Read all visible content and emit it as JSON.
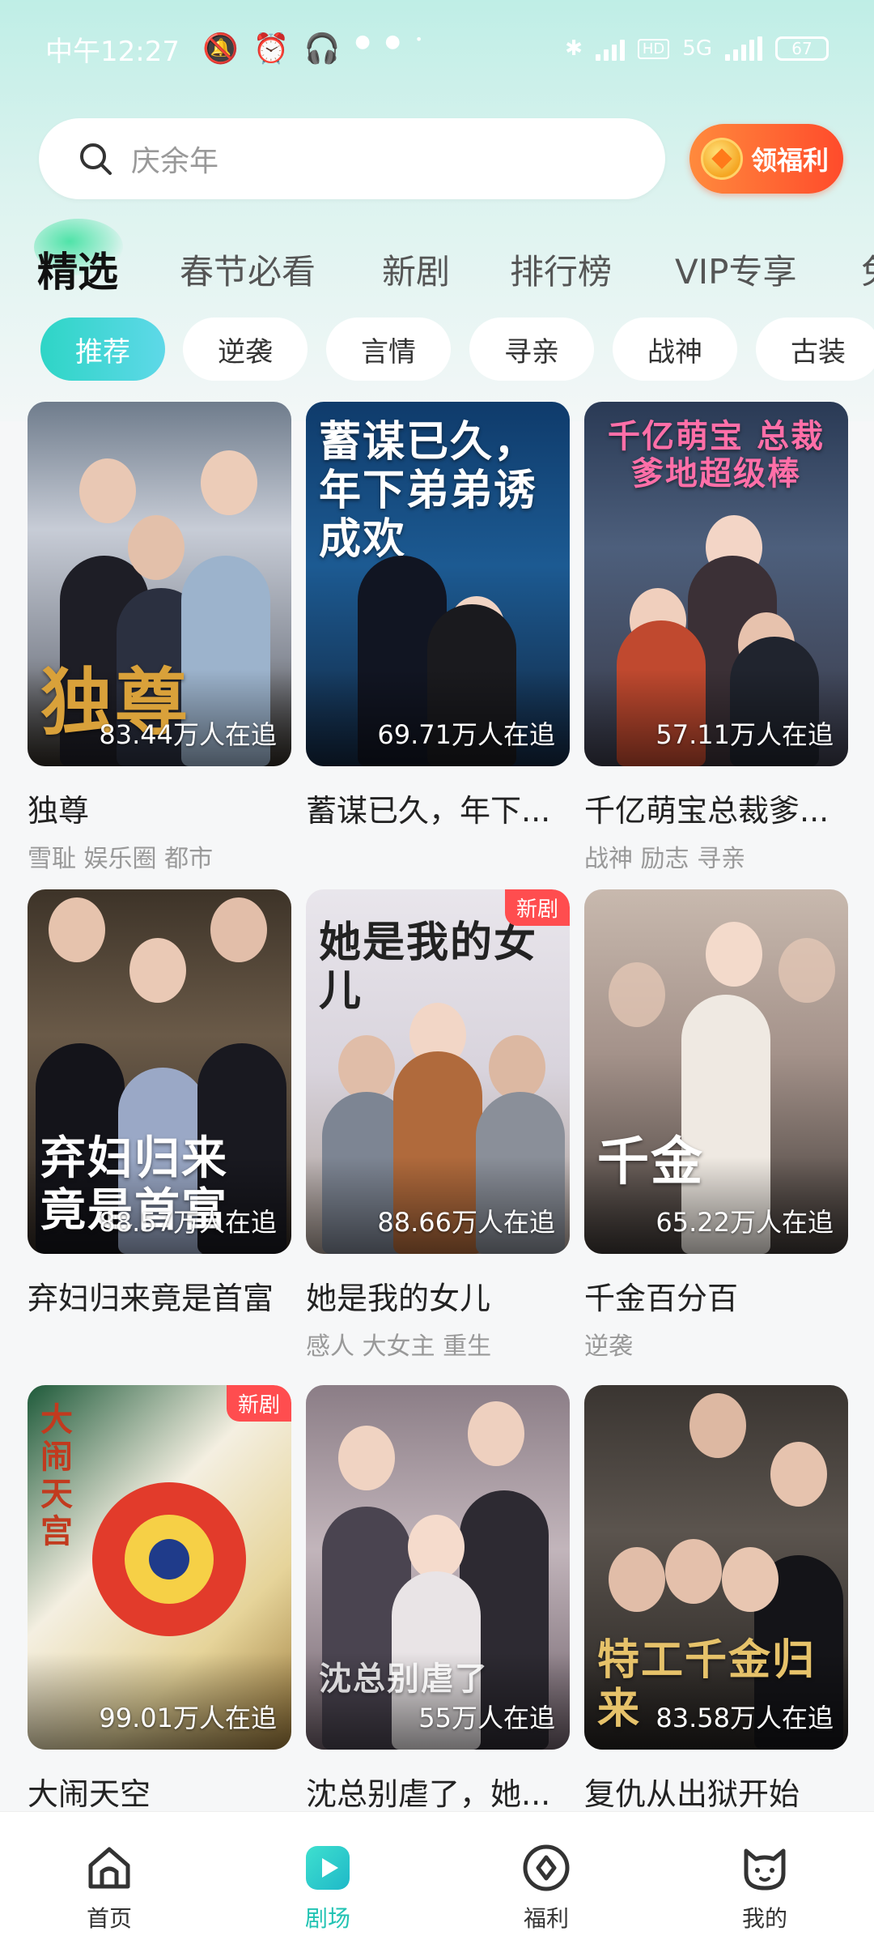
{
  "status_bar": {
    "time": "中午12:27",
    "network": "5G",
    "battery": "67"
  },
  "search": {
    "placeholder": "庆余年"
  },
  "welfare_button": {
    "label": "领福利"
  },
  "category_tabs": [
    {
      "label": "精选",
      "active": true
    },
    {
      "label": "春节必看",
      "active": false
    },
    {
      "label": "新剧",
      "active": false
    },
    {
      "label": "排行榜",
      "active": false
    },
    {
      "label": "VIP专享",
      "active": false
    },
    {
      "label": "免",
      "active": false
    }
  ],
  "genre_chips": [
    {
      "label": "推荐",
      "active": true
    },
    {
      "label": "逆袭",
      "active": false
    },
    {
      "label": "言情",
      "active": false
    },
    {
      "label": "寻亲",
      "active": false
    },
    {
      "label": "战神",
      "active": false
    },
    {
      "label": "古装",
      "active": false
    }
  ],
  "dramas": [
    {
      "title": "独尊",
      "followers": "83.44万人在追",
      "tags": "雪耻 娱乐圈 都市",
      "badge": "",
      "poster_text": "独尊"
    },
    {
      "title": "蓄谋已久，年下...",
      "followers": "69.71万人在追",
      "tags": "",
      "badge": "",
      "poster_text": "蓄谋已久，年下弟弟诱成欢"
    },
    {
      "title": "千亿萌宝总裁爹...",
      "followers": "57.11万人在追",
      "tags": "战神 励志 寻亲",
      "badge": "",
      "poster_text": "千亿萌宝 总裁爹地超级棒"
    },
    {
      "title": "弃妇归来竟是首富",
      "followers": "88.57万人在追",
      "tags": "",
      "badge": "",
      "poster_text": "弃妇归来 竟是首富"
    },
    {
      "title": "她是我的女儿",
      "followers": "88.66万人在追",
      "tags": "感人 大女主 重生",
      "badge": "新剧",
      "poster_text": "她是我的女儿"
    },
    {
      "title": "千金百分百",
      "followers": "65.22万人在追",
      "tags": "逆袭",
      "badge": "",
      "poster_text": "千金"
    },
    {
      "title": "大闹天空",
      "followers": "99.01万人在追",
      "tags": "",
      "badge": "新剧",
      "poster_text": "大闹天宫"
    },
    {
      "title": "沈总别虐了，她...",
      "followers": "55万人在追",
      "tags": "",
      "badge": "",
      "poster_text": "沈总别虐了"
    },
    {
      "title": "复仇从出狱开始",
      "followers": "83.58万人在追",
      "tags": "",
      "badge": "",
      "poster_text": "特工千金归来"
    }
  ],
  "bottom_nav": [
    {
      "label": "首页",
      "icon": "home-icon",
      "active": false
    },
    {
      "label": "剧场",
      "icon": "play-icon",
      "active": true
    },
    {
      "label": "福利",
      "icon": "welfare-icon",
      "active": false
    },
    {
      "label": "我的",
      "icon": "cat-profile-icon",
      "active": false
    }
  ],
  "colors": {
    "accent": "#22c3b3",
    "welfare_orange": "#ff5a2e",
    "badge_red": "#ff4d4f"
  }
}
